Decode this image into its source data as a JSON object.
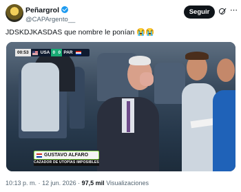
{
  "author": {
    "display_name": "Peñargrol",
    "handle": "@CAPArgento__",
    "verified": true,
    "avatar_icon": "avatar-image"
  },
  "actions": {
    "follow_label": "Seguir",
    "grok_icon": "grok-icon",
    "more_icon": "more-options-icon",
    "more_glyph": "⋯"
  },
  "tweet": {
    "text": "JDSKDJKASDAS que nombre le ponían 😭😭"
  },
  "media": {
    "scorebug": {
      "time": "00:53",
      "team1": "USA",
      "score1": "0",
      "score2": "0",
      "team2": "PAR"
    },
    "lower_third": {
      "name": "GUSTAVO ALFARO",
      "subtitle": "CAZADOR DE UTOPÍAS IMPOSIBLES"
    }
  },
  "meta": {
    "time": "10:13 p. m.",
    "separator": "·",
    "date": "12 jun. 2026",
    "views_count": "97,5 mil",
    "views_label": "Visualizaciones"
  },
  "colors": {
    "accent": "#1d9bf0",
    "text": "#0f1419",
    "muted": "#536471",
    "lower_third_border": "#8ee04a"
  }
}
